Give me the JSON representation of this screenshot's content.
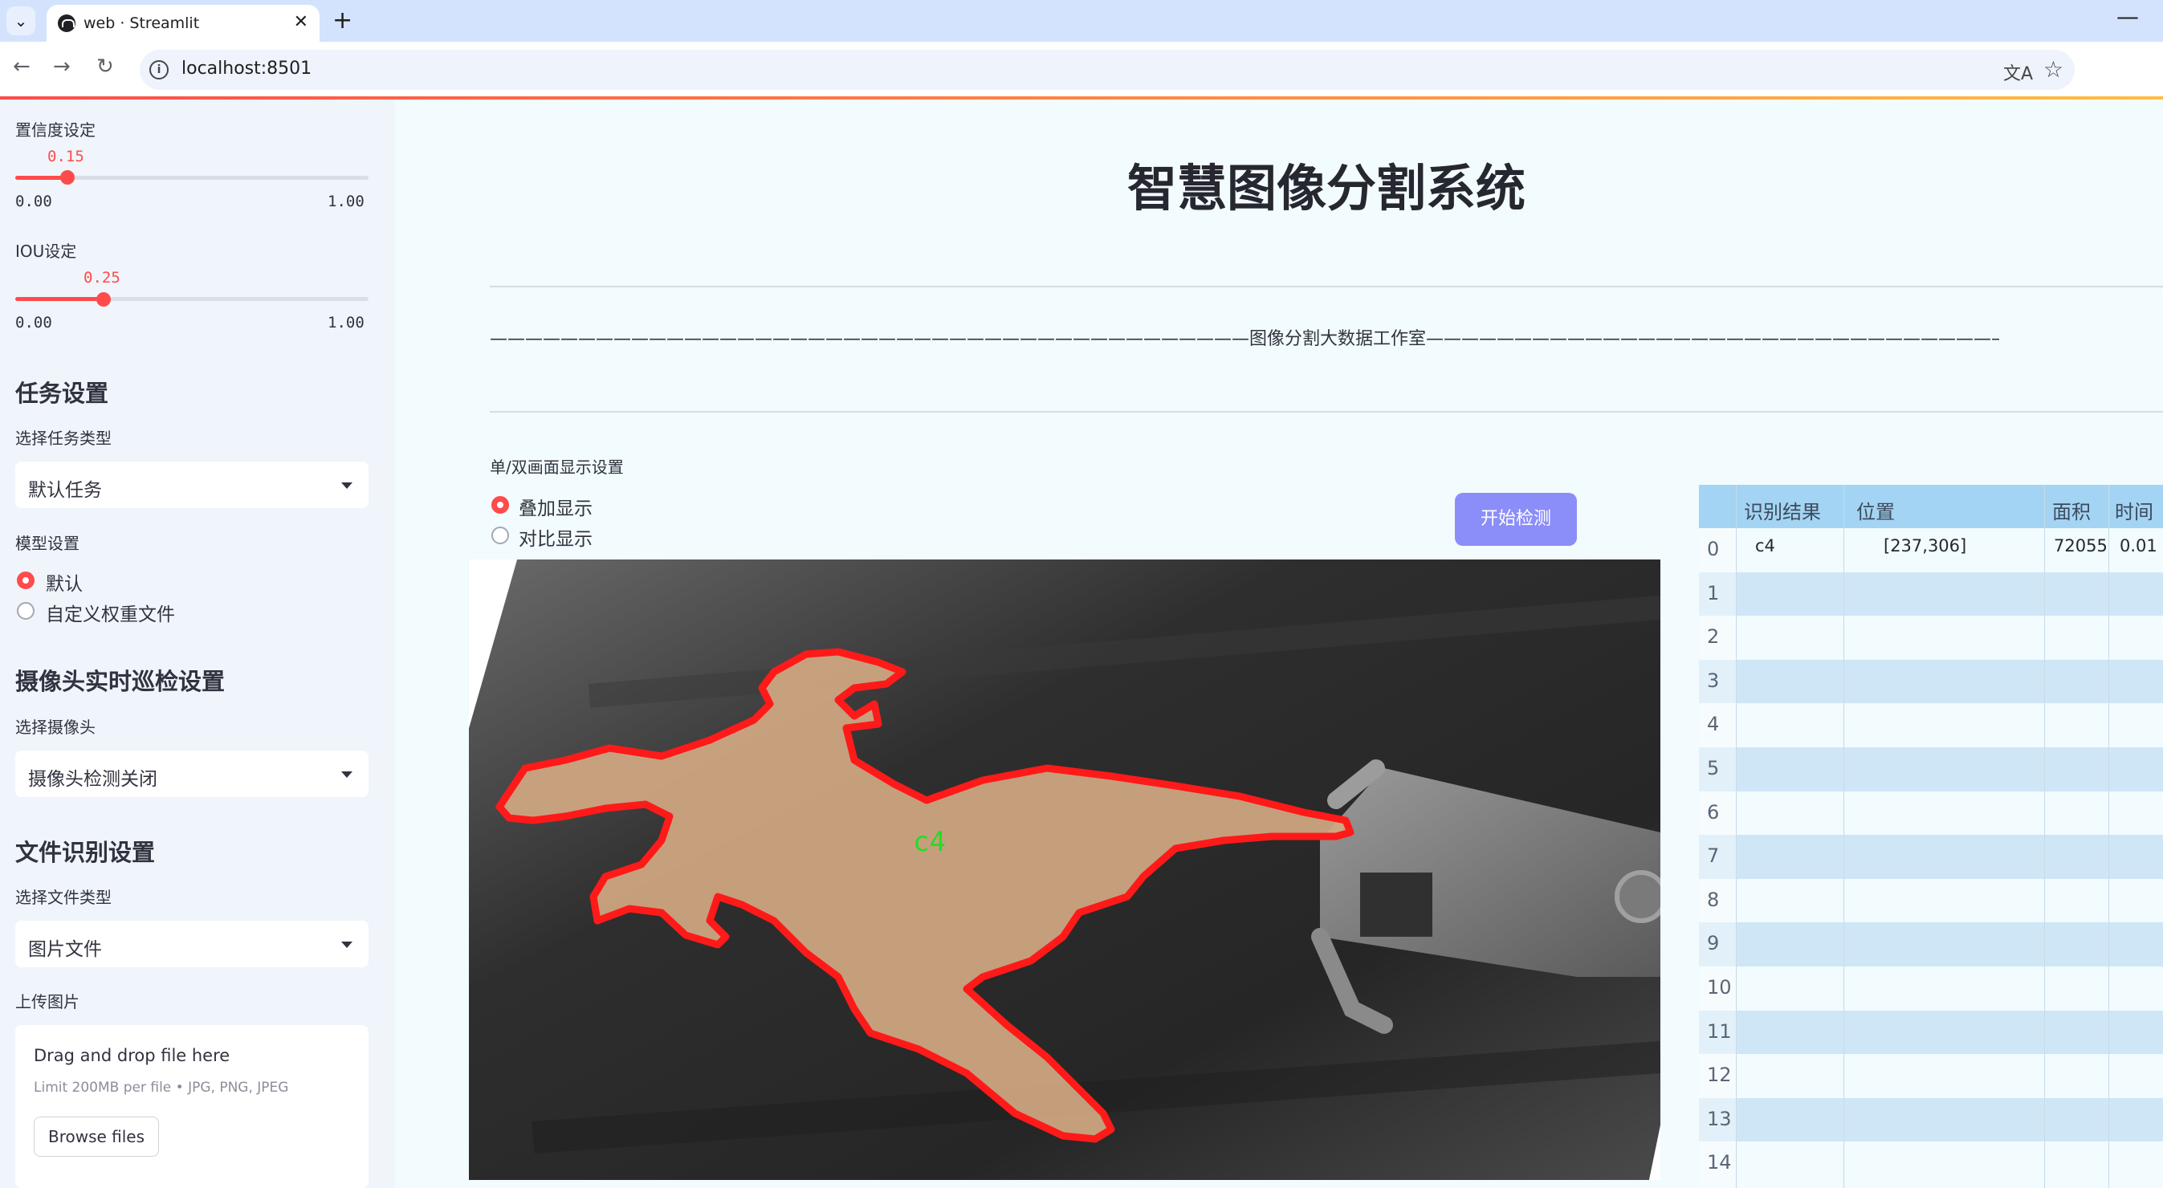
{
  "browser": {
    "tab_title": "web · Streamlit",
    "url": "localhost:8501"
  },
  "sidebar": {
    "conf": {
      "label": "置信度设定",
      "value": "0.15",
      "fraction": 0.15,
      "min": "0.00",
      "max": "1.00"
    },
    "iou": {
      "label": "IOU设定",
      "value": "0.25",
      "fraction": 0.25,
      "min": "0.00",
      "max": "1.00"
    },
    "task": {
      "heading": "任务设置",
      "label": "选择任务类型",
      "selected": "默认任务"
    },
    "model": {
      "label": "模型设置",
      "options": [
        "默认",
        "自定义权重文件"
      ],
      "selected_index": 0
    },
    "camera": {
      "heading": "摄像头实时巡检设置",
      "label": "选择摄像头",
      "selected": "摄像头检测关闭"
    },
    "file": {
      "heading": "文件识别设置",
      "label": "选择文件类型",
      "selected": "图片文件"
    },
    "upload": {
      "label": "上传图片",
      "drop_text": "Drag and drop file here",
      "limit_text": "Limit 200MB per file • JPG, PNG, JPEG",
      "browse_label": "Browse files"
    }
  },
  "main": {
    "title": "智慧图像分割系统",
    "studio_text": "———————————————————————————————————————————图像分割大数据工作室——————————————————————————————————————————",
    "display_mode": {
      "label": "单/双画面显示设置",
      "options": [
        "叠加显示",
        "对比显示"
      ],
      "selected_index": 0
    },
    "detect_button": "开始检测",
    "image": {
      "detection_label": "c4",
      "mask_color": "#d3a983",
      "outline_color": "#ff1a1a",
      "label_color": "#22dd22"
    }
  },
  "table": {
    "columns": [
      "识别结果",
      "位置",
      "面积",
      "时间"
    ],
    "row_indices": [
      "0",
      "1",
      "2",
      "3",
      "4",
      "5",
      "6",
      "7",
      "8",
      "9",
      "10",
      "11",
      "12",
      "13",
      "14"
    ],
    "rows": [
      {
        "result": "c4",
        "position": "[237,306]",
        "area": "72055",
        "time": "0.01"
      }
    ]
  },
  "colors": {
    "accent": "#ff4b4b",
    "button": "#8b8ef8",
    "table_header": "#a4d4f3"
  }
}
